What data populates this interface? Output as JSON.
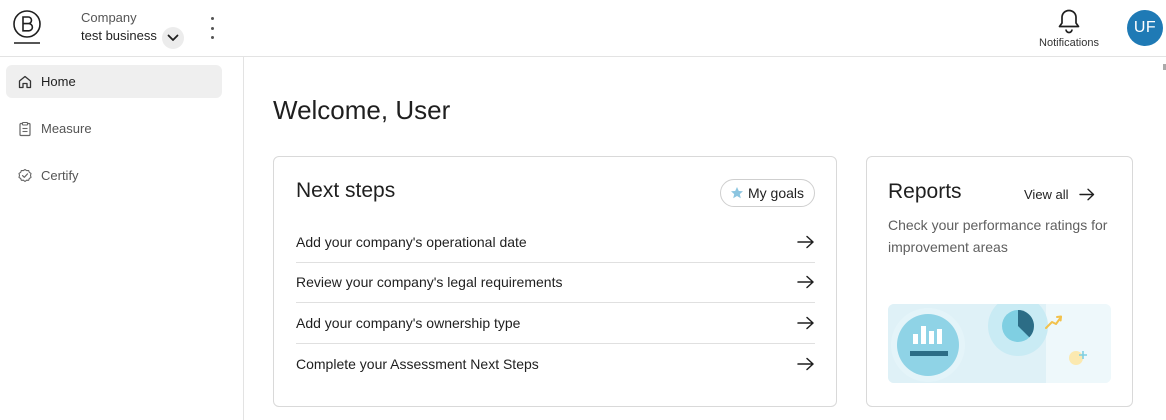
{
  "header": {
    "company_label": "Company",
    "company_name": "test business",
    "notifications_label": "Notifications",
    "avatar_initials": "UF",
    "avatar_color": "#1f7ab5"
  },
  "sidebar": {
    "items": [
      {
        "label": "Home",
        "icon": "home-icon",
        "active": true
      },
      {
        "label": "Measure",
        "icon": "clipboard-icon",
        "active": false
      },
      {
        "label": "Certify",
        "icon": "check-badge-icon",
        "active": false
      }
    ]
  },
  "main": {
    "welcome": "Welcome, User",
    "next_steps": {
      "title": "Next steps",
      "goals_button": "My goals",
      "items": [
        "Add your company's operational date",
        "Review your company's legal requirements",
        "Add your company's ownership type",
        "Complete your Assessment Next Steps"
      ]
    },
    "reports": {
      "title": "Reports",
      "view_all": "View all",
      "description": "Check your performance ratings for improvement areas"
    }
  }
}
